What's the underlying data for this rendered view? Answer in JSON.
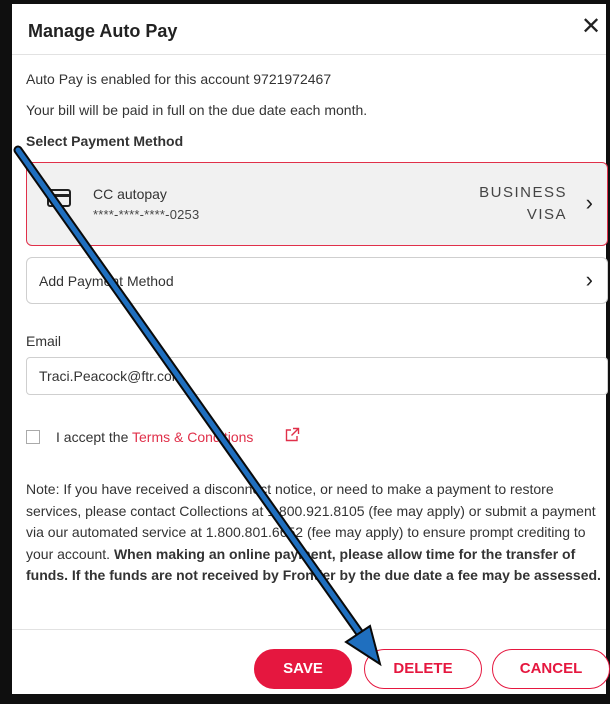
{
  "modal": {
    "title": "Manage Auto Pay",
    "close_glyph": "✕"
  },
  "info": {
    "enabled_text": "Auto Pay is enabled for this account 9721972467",
    "bill_text": "Your bill will be paid in full on the due date each month.",
    "select_heading": "Select Payment Method"
  },
  "payment_method": {
    "name": "CC autopay",
    "number": "****-****-****-0253",
    "type_line1": "BUSINESS",
    "type_line2": "VISA",
    "icon": "credit-card-icon",
    "selected": true,
    "border_color": "#e0304a"
  },
  "add_payment": {
    "label": "Add Payment Method"
  },
  "email": {
    "label": "Email",
    "value": "Traci.Peacock@ftr.com"
  },
  "terms": {
    "prefix": "I accept the ",
    "link_text": "Terms & Conditions",
    "checked": false,
    "icon": "external-link-icon"
  },
  "note": {
    "text": "Note: If you have received a disconnect notice, or need to make a payment to restore services, please contact Collections at 1.800.921.8105 (fee may apply) or submit a payment via our automated service at 1.800.801.6652 (fee may apply) to ensure prompt crediting to your account. ",
    "bold_text": "When making an online payment, please allow time for the transfer of funds. If the funds are not received by Frontier by the due date a fee may be assessed."
  },
  "buttons": {
    "save": "SAVE",
    "delete": "DELETE",
    "cancel": "CANCEL"
  },
  "colors": {
    "accent": "#e5173f",
    "annotation_arrow": "#1f6fbf"
  }
}
